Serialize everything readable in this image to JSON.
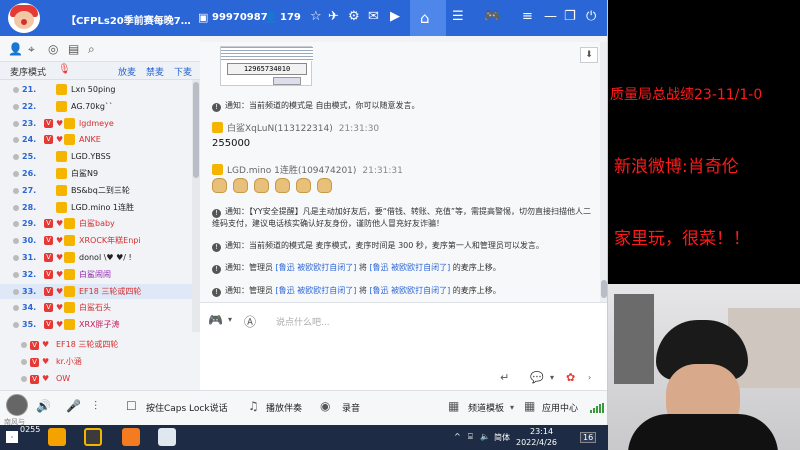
{
  "titlebar": {
    "channel_title": "【CFPLs20季前赛每晚7…",
    "channel_id": "99970987",
    "online_count": "179"
  },
  "queue": {
    "mode_label": "麦序模式",
    "actions": [
      "放麦",
      "禁麦",
      "下麦"
    ],
    "items": [
      {
        "num": "21.",
        "name": "Lxn 50ping",
        "v": false,
        "selected": false
      },
      {
        "num": "22.",
        "name": "AG.70kg``",
        "v": false,
        "selected": false
      },
      {
        "num": "23.",
        "name": "lgdmeye",
        "v": true,
        "selected": false,
        "name_color": "red"
      },
      {
        "num": "24.",
        "name": "ANKE",
        "v": true,
        "selected": false,
        "name_color": "red"
      },
      {
        "num": "25.",
        "name": "LGD.YBSS",
        "v": false,
        "selected": false
      },
      {
        "num": "26.",
        "name": "白鲨N9",
        "v": false,
        "selected": false
      },
      {
        "num": "27.",
        "name": "BS&bq二到三轮",
        "v": false,
        "selected": false
      },
      {
        "num": "28.",
        "name": "LGD.mino 1连胜",
        "v": false,
        "selected": false
      },
      {
        "num": "29.",
        "name": "白鲨baby",
        "v": true,
        "selected": false,
        "name_color": "red"
      },
      {
        "num": "30.",
        "name": "XROCK年糕Enpi",
        "v": true,
        "selected": false,
        "name_color": "red"
      },
      {
        "num": "31.",
        "name": "donol \\♥ ♥/ !",
        "v": true,
        "selected": false
      },
      {
        "num": "32.",
        "name": "白鲨闹闹",
        "v": true,
        "selected": false,
        "name_color": "purple"
      },
      {
        "num": "33.",
        "name": "EF18 三轮或四轮",
        "v": true,
        "selected": true,
        "name_color": "red"
      },
      {
        "num": "34.",
        "name": "白鲨石头",
        "v": true,
        "selected": false,
        "name_color": "red"
      },
      {
        "num": "35.",
        "name": "XRX胖子涛",
        "v": true,
        "selected": false,
        "name_color": "pink"
      }
    ]
  },
  "members": [
    {
      "name": "EF18 三轮或四轮",
      "color": "red"
    },
    {
      "name": "kr.小涵",
      "color": "red"
    },
    {
      "name": "OW",
      "color": "red"
    }
  ],
  "chat": {
    "image_digits": "12965734010",
    "messages": {
      "sys1": {
        "label": "通知：",
        "text": "当前频道的模式是 自由模式，你可以随意发言。"
      },
      "u1_name": "白鲨XqLuN(113122314)",
      "u1_time": "21:31:30",
      "u1_text": "255000",
      "u2_name": "LGD.mino 1连胜(109474201)",
      "u2_time": "21:31:31",
      "sys2": {
        "label": "通知：",
        "text": "【YY安全提醒】凡是主动加好友后，要“借钱、转账、充值”等，需提高警惕，切勿直接扫描他人二维码支付，建议电话核实确认好友身份，谨防他人冒充好友诈骗！"
      },
      "sys3": {
        "label": "通知：",
        "text": "当前频道的模式是 麦序模式，麦序时间是 300 秒，麦序第一人和管理员可以发言。"
      },
      "sys4": {
        "label": "通知：",
        "pre": "管理员",
        "link1": "[鲁迅 被欧欧打自闭了]",
        "mid": "将",
        "link2": "[鲁迅 被欧欧打自闭了]",
        "post": "的麦序上移。"
      },
      "sys5": {
        "label": "通知：",
        "pre": "管理员",
        "link1": "[鲁迅 被欧欧打自闭了]",
        "mid": "将",
        "link2": "[鲁迅 被欧欧打自闭了]",
        "post": "的麦序上移。"
      }
    },
    "input_placeholder": "说点什么吧..."
  },
  "bottom_bar": {
    "avatar_name": "南风与",
    "caps_label": "按住Caps Lock说话",
    "music_label": "播放伴奏",
    "record_label": "录音",
    "channel_template": "频道模板",
    "app_center": "应用中心"
  },
  "taskbar": {
    "ime": "简体",
    "time": "23:14",
    "date": "2022/4/26",
    "notif_count": "16",
    "count_left": "0255"
  },
  "overlay": {
    "line1": "质量局总战绩23-11/1-0",
    "line2": "新浪微博:肖奇伦",
    "line3": "家里玩，很菜！！"
  },
  "colors": {
    "titlebar": "#2a66d6",
    "overlay_text": "#ff1a1a"
  }
}
